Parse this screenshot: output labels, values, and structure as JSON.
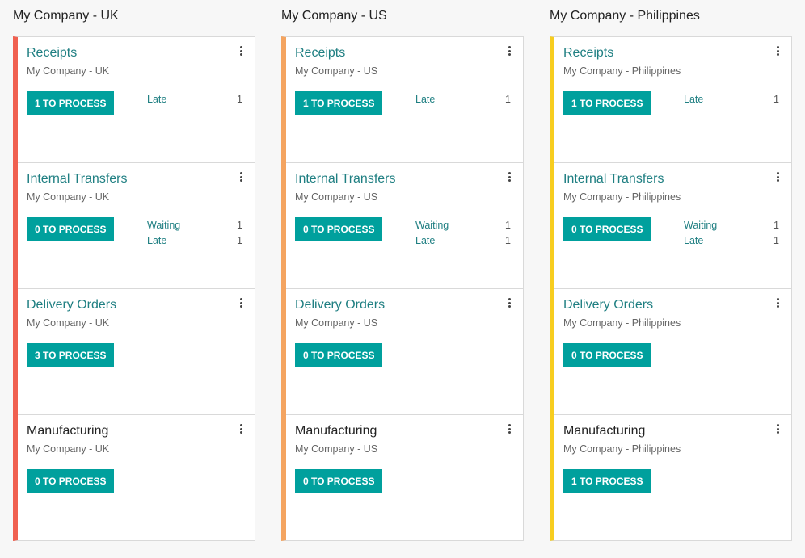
{
  "columns": [
    {
      "title": "My Company - UK",
      "accent": "#f06050",
      "cards": [
        {
          "title": "Receipts",
          "company": "My Company - UK",
          "button": "1 TO PROCESS",
          "stats": [
            {
              "label": "Late",
              "count": "1"
            }
          ]
        },
        {
          "title": "Internal Transfers",
          "company": "My Company - UK",
          "button": "0 TO PROCESS",
          "stats": [
            {
              "label": "Waiting",
              "count": "1"
            },
            {
              "label": "Late",
              "count": "1"
            }
          ]
        },
        {
          "title": "Delivery Orders",
          "company": "My Company - UK",
          "button": "3 TO PROCESS",
          "stats": []
        },
        {
          "title": "Manufacturing",
          "company": "My Company - UK",
          "button": "0 TO PROCESS",
          "stats": []
        }
      ]
    },
    {
      "title": "My Company - US",
      "accent": "#f4a460",
      "cards": [
        {
          "title": "Receipts",
          "company": "My Company - US",
          "button": "1 TO PROCESS",
          "stats": [
            {
              "label": "Late",
              "count": "1"
            }
          ]
        },
        {
          "title": "Internal Transfers",
          "company": "My Company - US",
          "button": "0 TO PROCESS",
          "stats": [
            {
              "label": "Waiting",
              "count": "1"
            },
            {
              "label": "Late",
              "count": "1"
            }
          ]
        },
        {
          "title": "Delivery Orders",
          "company": "My Company - US",
          "button": "0 TO PROCESS",
          "stats": []
        },
        {
          "title": "Manufacturing",
          "company": "My Company - US",
          "button": "0 TO PROCESS",
          "stats": []
        }
      ]
    },
    {
      "title": "My Company - Philippines",
      "accent": "#f7cd1f",
      "cards": [
        {
          "title": "Receipts",
          "company": "My Company - Philippines",
          "button": "1 TO PROCESS",
          "stats": [
            {
              "label": "Late",
              "count": "1"
            }
          ]
        },
        {
          "title": "Internal Transfers",
          "company": "My Company - Philippines",
          "button": "0 TO PROCESS",
          "stats": [
            {
              "label": "Waiting",
              "count": "1"
            },
            {
              "label": "Late",
              "count": "1"
            }
          ]
        },
        {
          "title": "Delivery Orders",
          "company": "My Company - Philippines",
          "button": "0 TO PROCESS",
          "stats": []
        },
        {
          "title": "Manufacturing",
          "company": "My Company - Philippines",
          "button": "1 TO PROCESS",
          "stats": []
        }
      ]
    }
  ],
  "icons": {
    "card_menu": "kebab-menu-icon"
  },
  "colors": {
    "title_link": "#1f7f82",
    "button_bg": "#00a09d"
  }
}
